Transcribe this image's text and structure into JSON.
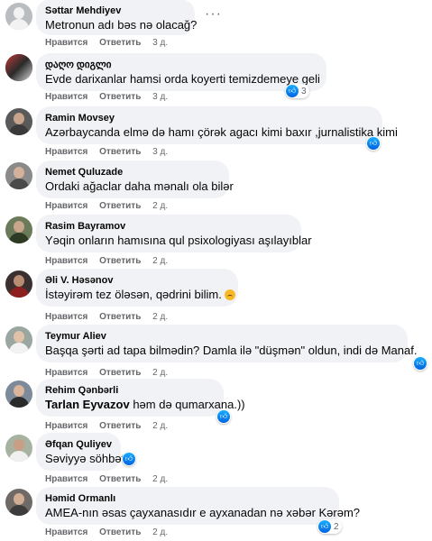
{
  "actions": {
    "like": "Нравится",
    "reply": "Ответить"
  },
  "comments": [
    {
      "name": "Səttar Mehdiyev",
      "text": "Metronun adı bəs nə olacağ?",
      "time": "3 д.",
      "more": "···"
    },
    {
      "name": "დაღო დიგლი",
      "text": "Evde darixanlar hamsi orda koyerti temizdemeye geli",
      "time": "3 д.",
      "reactions": "3"
    },
    {
      "name": "Ramin Movsey",
      "text": "Azərbaycanda elmə də hamı çörək agacı kimi baxır ,jurnalistika kimi",
      "time": "3 д."
    },
    {
      "name": "Nemet Quluzade",
      "text": "Ordaki ağaclar daha mənalı ola bilər",
      "time": "2 д."
    },
    {
      "name": "Rasim Bayramov",
      "text": "Yəqin onların hamısına qul psixologiyası aşılayıblar",
      "time": "2 д."
    },
    {
      "name": "Əli V. Həsənov",
      "text": "İstəyirəm tez öləsən, qədrini bilim.",
      "time": "2 д."
    },
    {
      "name": "Teymur Aliev",
      "text": "Başqa şərti ad tapa bilmədin? Damla ilə \"düşmən\" oldun, indi də Manaf.",
      "time": "2 д."
    },
    {
      "name": "Rehim Qənbərli",
      "mention": "Tarlan Eyvazov",
      "text": " həm də qumarxana.))",
      "time": "2 д."
    },
    {
      "name": "Əfqan Quliyev",
      "text": "Səviyyə söhbət",
      "time": "2 д."
    },
    {
      "name": "Həmid Ormanlı",
      "text": "AMEA-nın əsas çayxanasıdır e ayxanadan nə xəbər Kərəm?",
      "time": "2 д.",
      "reactions": "2"
    }
  ],
  "colors": {
    "bubble": "#f0f2f5",
    "meta": "#65676b",
    "like": "#1877f2"
  }
}
